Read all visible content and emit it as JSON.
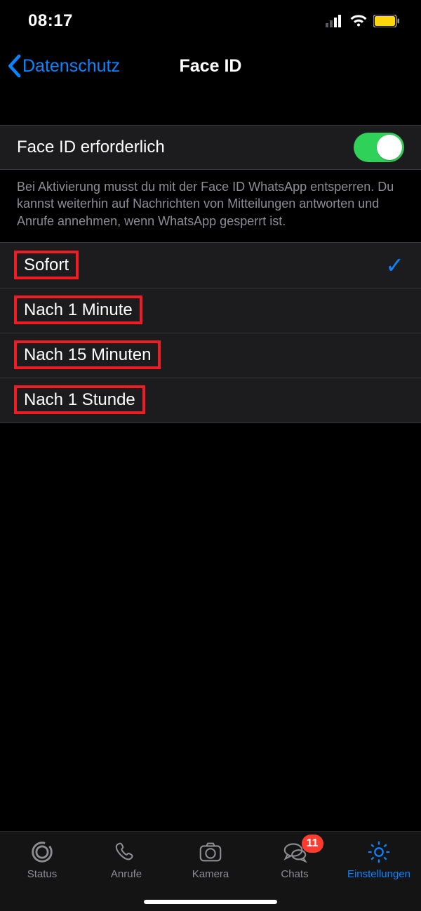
{
  "statusbar": {
    "time": "08:17"
  },
  "nav": {
    "back_label": "Datenschutz",
    "title": "Face ID"
  },
  "faceid_group": {
    "require_label": "Face ID erforderlich",
    "require_on": true,
    "footer": "Bei Aktivierung musst du mit der Face ID WhatsApp entsperren. Du kannst weiterhin auf Nachrichten von Mitteilungen antworten und Anrufe annehmen, wenn WhatsApp gesperrt ist."
  },
  "lock_options": [
    {
      "label": "Sofort",
      "selected": true,
      "highlighted": true
    },
    {
      "label": "Nach 1 Minute",
      "selected": false,
      "highlighted": true
    },
    {
      "label": "Nach 15 Minuten",
      "selected": false,
      "highlighted": true
    },
    {
      "label": "Nach 1 Stunde",
      "selected": false,
      "highlighted": true
    }
  ],
  "tabs": {
    "status": "Status",
    "calls": "Anrufe",
    "camera": "Kamera",
    "chats": "Chats",
    "chats_badge": "11",
    "settings": "Einstellungen"
  },
  "colors": {
    "accent": "#0a84ff",
    "toggle_on": "#30d158",
    "badge": "#ff3b30",
    "highlight": "#ef1c24"
  }
}
